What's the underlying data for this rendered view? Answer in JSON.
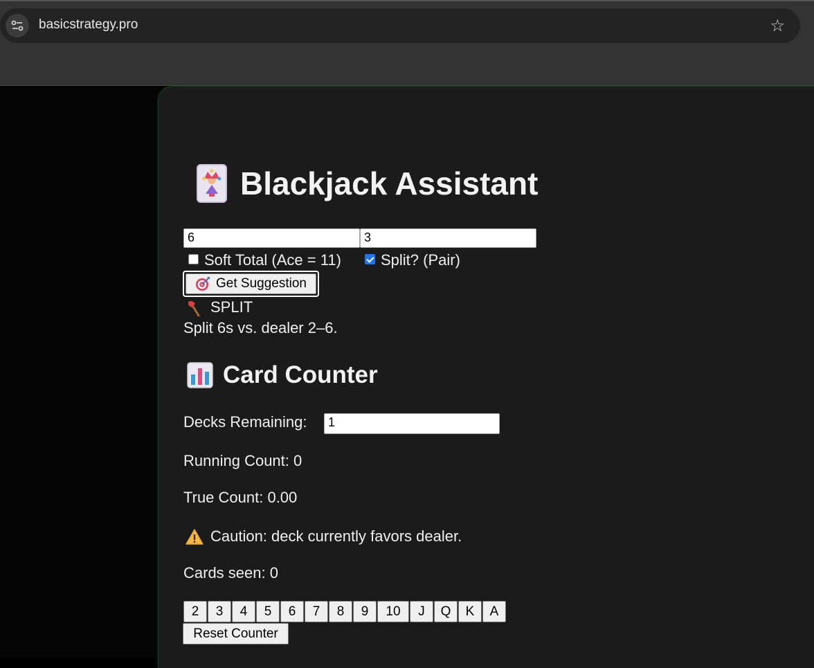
{
  "browser": {
    "url": "basicstrategy.pro",
    "icons": [
      "site-info-icon",
      "bookmark-star-icon"
    ]
  },
  "header": {
    "title": "Blackjack Assistant",
    "icon": "joker-card-icon"
  },
  "strategy": {
    "player_total_value": "6",
    "dealer_card_value": "3",
    "soft_total_label": "Soft Total (Ace = 11)",
    "soft_total_checked": false,
    "split_label": "Split? (Pair)",
    "split_checked": true,
    "suggest_button_label": "Get Suggestion",
    "suggest_icon": "target-icon",
    "result_action": "SPLIT",
    "result_icon": "axe-icon",
    "result_explanation": "Split 6s vs. dealer 2–6."
  },
  "counter": {
    "title": "Card Counter",
    "icon": "bar-chart-icon",
    "decks_label": "Decks Remaining:",
    "decks_value": "1",
    "running_count_text": "Running Count: 0",
    "true_count_text": "True Count: 0.00",
    "caution_text": "Caution: deck currently favors dealer.",
    "caution_icon": "warning-icon",
    "cards_seen_text": "Cards seen: 0",
    "card_buttons": [
      "2",
      "3",
      "4",
      "5",
      "6",
      "7",
      "8",
      "9",
      "10",
      "J",
      "Q",
      "K",
      "A"
    ],
    "reset_label": "Reset Counter"
  },
  "colors": {
    "page_bg": "#000000",
    "card_bg": "#1b1b1b",
    "text": "#f0f0f0",
    "checkbox_checked": "#1f74e8"
  }
}
